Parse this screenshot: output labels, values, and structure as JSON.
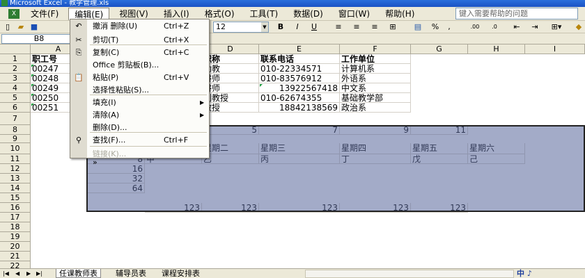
{
  "window": {
    "title": "Microsoft Excel - 教学管理.xls"
  },
  "menubar": {
    "items": [
      "文件(F)",
      "编辑(E)",
      "视图(V)",
      "插入(I)",
      "格式(O)",
      "工具(T)",
      "数据(D)",
      "窗口(W)",
      "帮助(H)"
    ],
    "help_placeholder": "键入需要帮助的问题"
  },
  "toolbar": {
    "font_size": "12",
    "bold": "B",
    "italic": "I",
    "underline": "U",
    "percent": "%",
    "comma": ",",
    "dec": ".00"
  },
  "formula_bar": {
    "name_box": "B8"
  },
  "columns": [
    "A",
    "B",
    "C",
    "D",
    "E",
    "F",
    "G",
    "H",
    "I"
  ],
  "rows": [
    "1",
    "2",
    "3",
    "4",
    "5",
    "6",
    "7",
    "8",
    "9",
    "10",
    "11",
    "12",
    "13",
    "14",
    "15",
    "16",
    "17",
    "18",
    "19",
    "20",
    "21",
    "22"
  ],
  "cells": {
    "A1": "职工号",
    "A2": "00247",
    "A3": "00248",
    "A4": "00249",
    "A5": "00250",
    "A6": "00251",
    "D1": "职称",
    "D2": "助教",
    "D3": "讲师",
    "D4": "讲师",
    "D5": "副教授",
    "D6": "教授",
    "E1": "联系电话",
    "E2": "010-22334571",
    "E3": "010-83576912",
    "E4": "13922567418",
    "E5": "010-62674355",
    "E6": "18842138569",
    "F1": "工作单位",
    "F2": "计算机系",
    "F3": "外语系",
    "F4": "中文系",
    "F5": "基础教学部",
    "F6": "政治系",
    "D8": "5",
    "E8": "7",
    "F8": "9",
    "G8": "11",
    "C10": "星期一",
    "D10": "星期二",
    "E10": "星期三",
    "F10": "星期四",
    "G10": "星期五",
    "H10": "星期六",
    "C11": "甲",
    "D11": "乙",
    "E11": "丙",
    "F11": "丁",
    "G11": "戊",
    "H11": "己",
    "B11": "8",
    "B12": "16",
    "B13": "32",
    "B14": "64",
    "C16": "123",
    "D16": "123",
    "E16": "123",
    "F16": "123",
    "G16": "123"
  },
  "edit_menu": {
    "items": [
      {
        "icon": "undo-icon",
        "label": "撤消 删除(U)",
        "shortcut": "Ctrl+Z",
        "disabled": false
      },
      {
        "icon": "cut-icon",
        "label": "剪切(T)",
        "shortcut": "Ctrl+X",
        "disabled": false
      },
      {
        "icon": "copy-icon",
        "label": "复制(C)",
        "shortcut": "Ctrl+C",
        "disabled": false
      },
      {
        "icon": "",
        "label": "Office 剪贴板(B)...",
        "shortcut": "",
        "disabled": false
      },
      {
        "icon": "paste-icon",
        "label": "粘贴(P)",
        "shortcut": "Ctrl+V",
        "disabled": false
      },
      {
        "icon": "",
        "label": "选择性粘贴(S)...",
        "shortcut": "",
        "disabled": false
      },
      {
        "icon": "",
        "label": "填充(I)",
        "shortcut": "",
        "submenu": true,
        "disabled": false
      },
      {
        "icon": "",
        "label": "清除(A)",
        "shortcut": "",
        "submenu": true,
        "disabled": false
      },
      {
        "icon": "",
        "label": "删除(D)...",
        "shortcut": "",
        "disabled": false
      },
      {
        "icon": "find-icon",
        "label": "查找(F)...",
        "shortcut": "Ctrl+F",
        "disabled": false
      },
      {
        "icon": "",
        "label": "链接(K)...",
        "shortcut": "",
        "disabled": true
      },
      {
        "icon": "",
        "label": "»",
        "shortcut": "",
        "disabled": false
      }
    ]
  },
  "sheet_tabs": [
    "任课教师表",
    "辅导员表",
    "课程安排表"
  ],
  "ime": "中 ♪"
}
